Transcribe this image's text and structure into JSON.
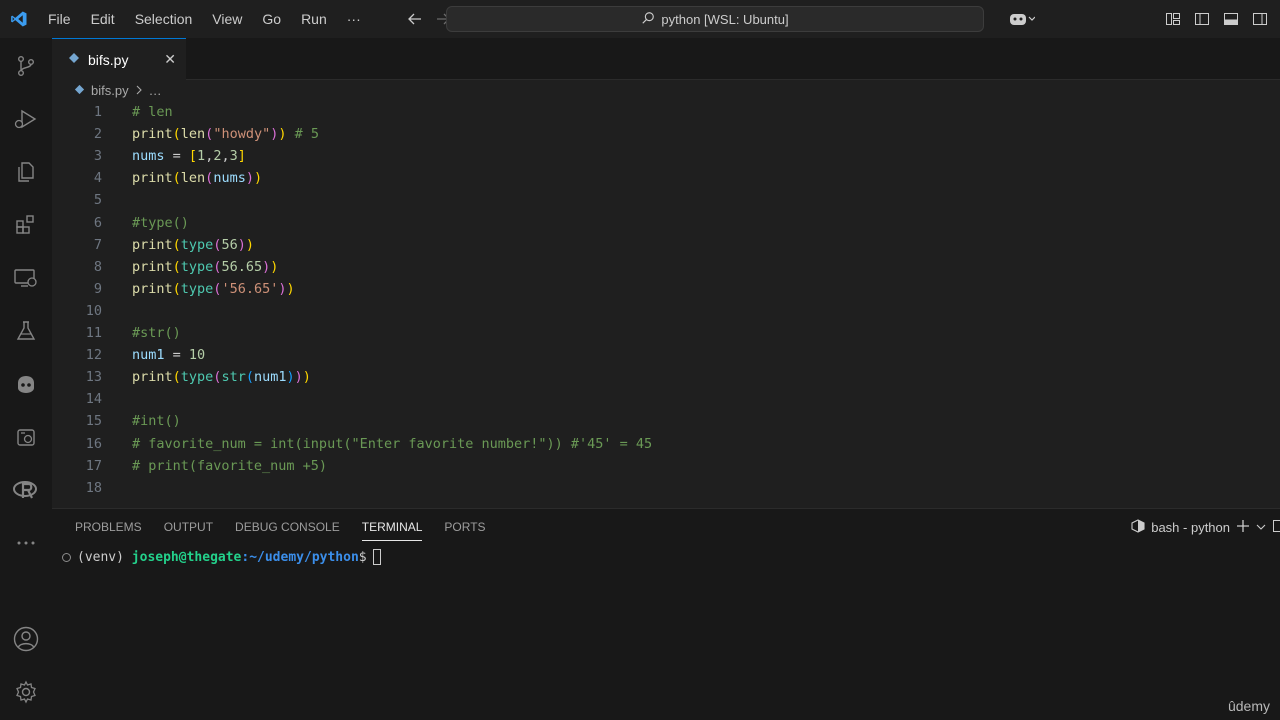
{
  "titlebar": {
    "menu": [
      "File",
      "Edit",
      "Selection",
      "View",
      "Go",
      "Run",
      "···"
    ],
    "search_text": "python [WSL: Ubuntu]"
  },
  "activity": [
    "source-control-icon",
    "run-debug-icon",
    "explorer-icon",
    "extensions-icon",
    "remote-explorer-icon",
    "testing-icon",
    "copilot-icon",
    "docker-icon",
    "r-icon",
    "more-icon",
    "account-icon",
    "manage-gear-icon"
  ],
  "tab": {
    "label": "bifs.py",
    "close": "✕"
  },
  "breadcrumb": {
    "file": "bifs.py",
    "rest": "…"
  },
  "editor": {
    "lines": [
      {
        "n": "1"
      },
      {
        "n": "2"
      },
      {
        "n": "3"
      },
      {
        "n": "4"
      },
      {
        "n": "5"
      },
      {
        "n": "6"
      },
      {
        "n": "7"
      },
      {
        "n": "8"
      },
      {
        "n": "9"
      },
      {
        "n": "10"
      },
      {
        "n": "11"
      },
      {
        "n": "12"
      },
      {
        "n": "13"
      },
      {
        "n": "14"
      },
      {
        "n": "15"
      },
      {
        "n": "16"
      },
      {
        "n": "17"
      },
      {
        "n": "18"
      }
    ],
    "tokens": [
      [
        [
          "# len",
          "com"
        ]
      ],
      [
        [
          "print",
          "fn"
        ],
        [
          "(",
          "p1"
        ],
        [
          "len",
          "fn"
        ],
        [
          "(",
          "p2"
        ],
        [
          "\"howdy\"",
          "str"
        ],
        [
          ")",
          "p2"
        ],
        [
          ")",
          "p1"
        ],
        [
          " ",
          "pl"
        ],
        [
          "# 5",
          "com"
        ]
      ],
      [
        [
          "nums",
          "var"
        ],
        [
          " = ",
          "pl"
        ],
        [
          "[",
          "p1"
        ],
        [
          "1",
          "num"
        ],
        [
          ",",
          "pl"
        ],
        [
          "2",
          "num"
        ],
        [
          ",",
          "pl"
        ],
        [
          "3",
          "num"
        ],
        [
          "]",
          "p1"
        ]
      ],
      [
        [
          "print",
          "fn"
        ],
        [
          "(",
          "p1"
        ],
        [
          "len",
          "fn"
        ],
        [
          "(",
          "p2"
        ],
        [
          "nums",
          "var"
        ],
        [
          ")",
          "p2"
        ],
        [
          ")",
          "p1"
        ]
      ],
      [],
      [
        [
          "#type()",
          "com"
        ]
      ],
      [
        [
          "print",
          "fn"
        ],
        [
          "(",
          "p1"
        ],
        [
          "type",
          "cls"
        ],
        [
          "(",
          "p2"
        ],
        [
          "56",
          "num"
        ],
        [
          ")",
          "p2"
        ],
        [
          ")",
          "p1"
        ]
      ],
      [
        [
          "print",
          "fn"
        ],
        [
          "(",
          "p1"
        ],
        [
          "type",
          "cls"
        ],
        [
          "(",
          "p2"
        ],
        [
          "56.65",
          "num"
        ],
        [
          ")",
          "p2"
        ],
        [
          ")",
          "p1"
        ]
      ],
      [
        [
          "print",
          "fn"
        ],
        [
          "(",
          "p1"
        ],
        [
          "type",
          "cls"
        ],
        [
          "(",
          "p2"
        ],
        [
          "'56.65'",
          "str"
        ],
        [
          ")",
          "p2"
        ],
        [
          ")",
          "p1"
        ]
      ],
      [],
      [
        [
          "#str()",
          "com"
        ]
      ],
      [
        [
          "num1",
          "var"
        ],
        [
          " = ",
          "pl"
        ],
        [
          "10",
          "num"
        ]
      ],
      [
        [
          "print",
          "fn"
        ],
        [
          "(",
          "p1"
        ],
        [
          "type",
          "cls"
        ],
        [
          "(",
          "p2"
        ],
        [
          "str",
          "cls"
        ],
        [
          "(",
          "p3"
        ],
        [
          "num1",
          "var"
        ],
        [
          ")",
          "p3"
        ],
        [
          ")",
          "p2"
        ],
        [
          ")",
          "p1"
        ]
      ],
      [],
      [
        [
          "#int()",
          "com"
        ]
      ],
      [
        [
          "# favorite_num = int(input(\"Enter favorite number!\")) #'45' = 45",
          "com"
        ]
      ],
      [
        [
          "# print(favorite_num +5)",
          "com"
        ]
      ],
      []
    ]
  },
  "panel": {
    "tabs": [
      "PROBLEMS",
      "OUTPUT",
      "DEBUG CONSOLE",
      "TERMINAL",
      "PORTS"
    ],
    "active_tab": "TERMINAL",
    "terminal_name": "bash - python",
    "prompt": {
      "venv": "(venv) ",
      "user": "joseph@thegate",
      "path": ":~/udemy/python",
      "dollar": "$"
    }
  },
  "watermark": "ûdemy",
  "colors": {
    "accent": "#0078d4",
    "editor_bg": "#1f1f1f",
    "chrome_bg": "#181818"
  }
}
